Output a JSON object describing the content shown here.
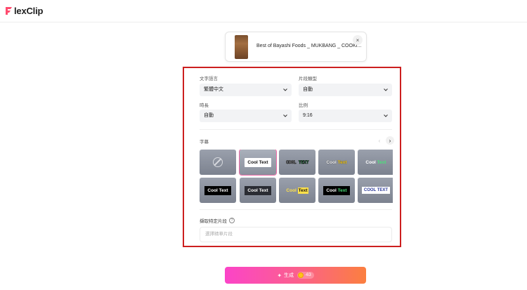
{
  "app": {
    "logo_text": "lexClip"
  },
  "file": {
    "name": "Best of Bayashi Foods _ MUKBANG _ COOKI...",
    "close_glyph": "×"
  },
  "settings": {
    "language": {
      "label": "文字語言",
      "value": "繁體中文"
    },
    "clip_type": {
      "label": "片段類型",
      "value": "自動"
    },
    "duration": {
      "label": "時長",
      "value": "自動"
    },
    "ratio": {
      "label": "比例",
      "value": "9:16"
    }
  },
  "subtitles": {
    "label": "字幕",
    "styles": [
      {
        "text": "",
        "kind": "none"
      },
      {
        "text": "Cool Text",
        "kind": "white-box",
        "selected": true
      },
      {
        "text": "COOL TEXT",
        "kind": "outline-green"
      },
      {
        "text": "Cool Text",
        "kind": "white-yellow"
      },
      {
        "text": "Cool Text",
        "kind": "white-green"
      },
      {
        "text": "Cool Text",
        "kind": "black-box"
      },
      {
        "text": "Cool Text",
        "kind": "dark-box-white"
      },
      {
        "text": "Cool Text",
        "kind": "yellow-black"
      },
      {
        "text": "Cool Text",
        "kind": "black-green"
      },
      {
        "text": "COOL TEXT",
        "kind": "white-blue"
      }
    ]
  },
  "extract": {
    "label": "擷取特定片段",
    "help": "?",
    "placeholder": "選擇精華片段"
  },
  "generate": {
    "label": "生成",
    "credits": "-63"
  },
  "colors": {
    "accent_border": "#cc1f1f",
    "selected_tile": "#f06aa8"
  }
}
